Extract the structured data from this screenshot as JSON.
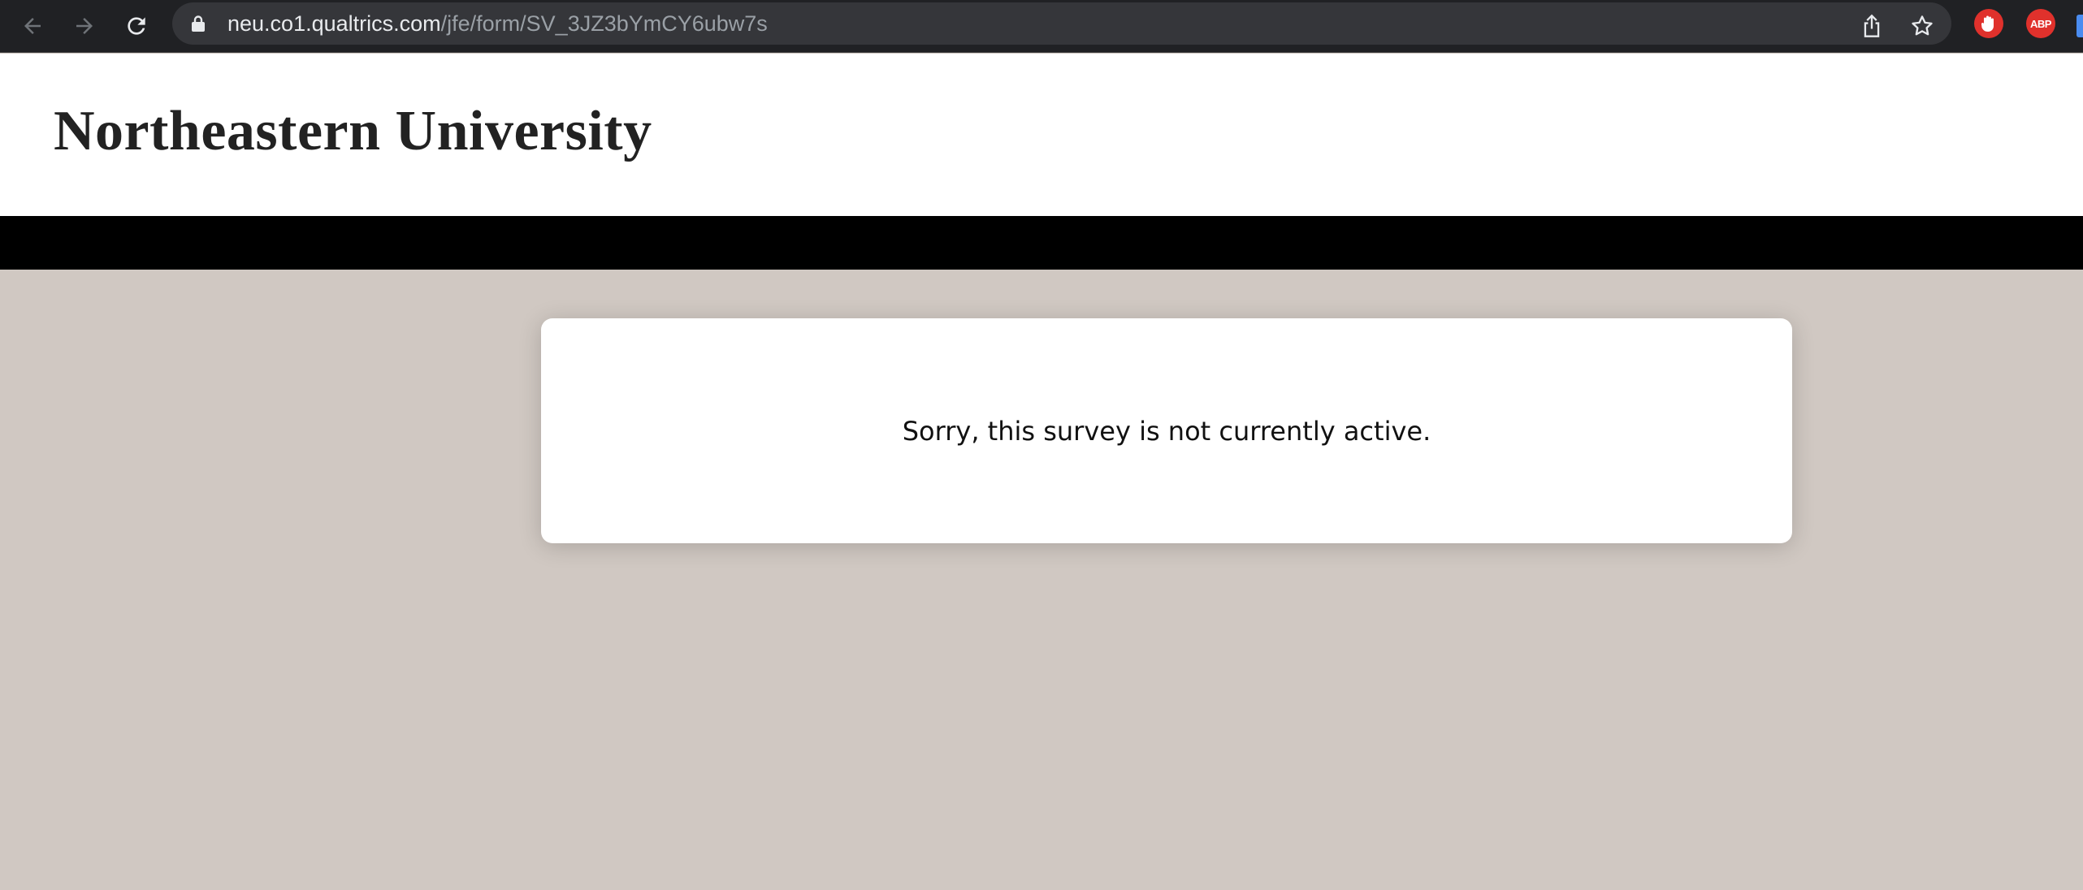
{
  "browser": {
    "url_host": "neu.co1.qualtrics.com",
    "url_path": "/jfe/form/SV_3JZ3bYmCY6ubw7s",
    "extensions": {
      "abp_label": "ABP"
    }
  },
  "header": {
    "title": "Northeastern University"
  },
  "main": {
    "message": "Sorry, this survey is not currently active."
  },
  "colors": {
    "toolbar_bg": "#202124",
    "page_bg": "#d0c8c2",
    "header_bar": "#000000",
    "extension_red": "#e0312c"
  }
}
